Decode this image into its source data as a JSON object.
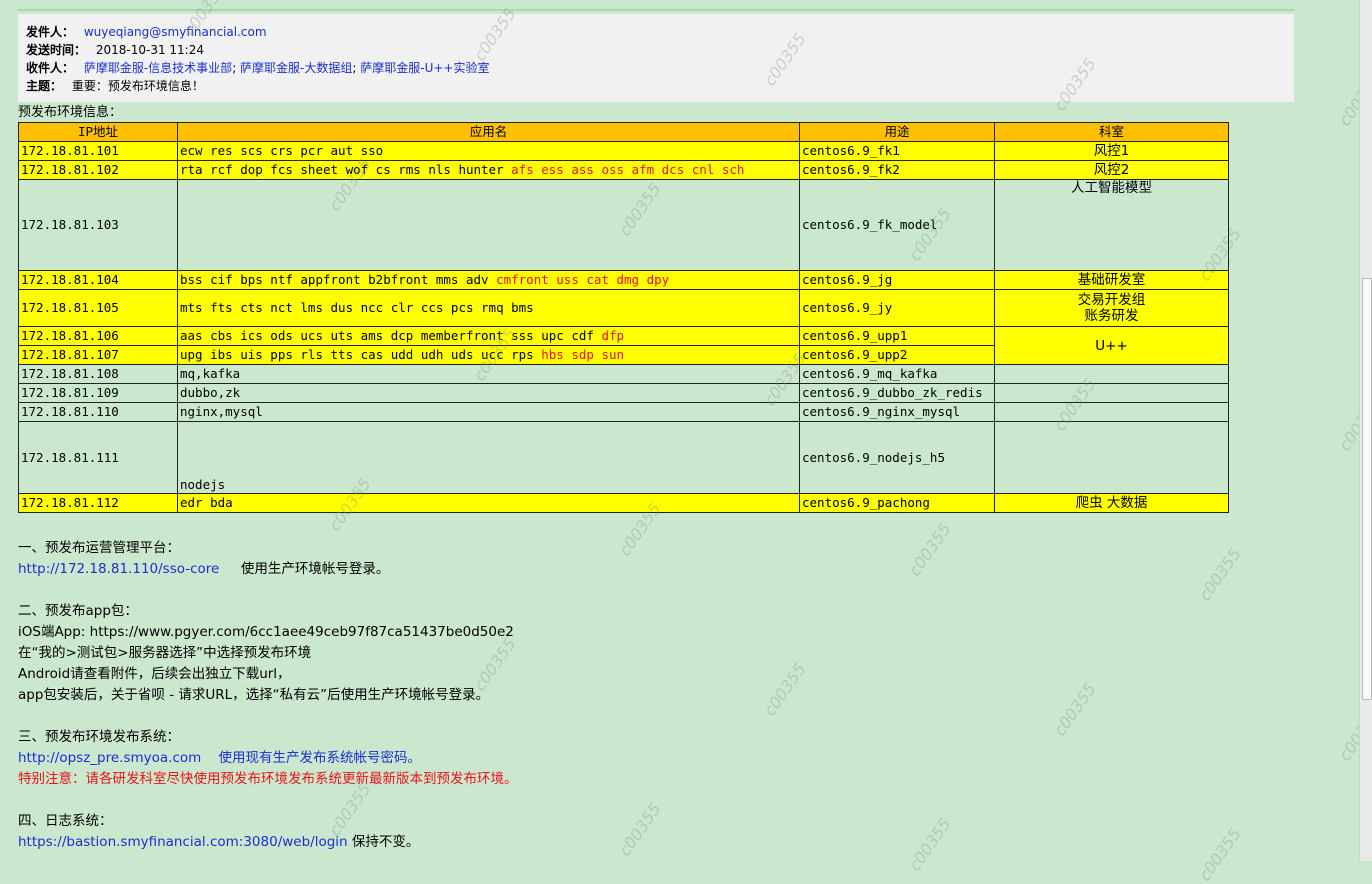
{
  "email": {
    "from_label": "发件人：",
    "from": "wuyeqiang@smyfinancial.com",
    "sent_label": "发送时间：",
    "sent": "2018-10-31 11:24",
    "to_label": "收件人：",
    "to": [
      "萨摩耶金服-信息技术事业部",
      "萨摩耶金服-大数据组",
      "萨摩耶金服-U++实验室"
    ],
    "subject_label": "主题：",
    "subject": "重要：预发布环境信息！"
  },
  "intro": "预发布环境信息：",
  "table": {
    "headers": [
      "IP地址",
      "应用名",
      "用途",
      "科室"
    ],
    "rows": [
      {
        "ip": "172.18.81.101",
        "apps": "ecw res scs crs pcr aut sso",
        "apps_red": "",
        "use": "centos6.9_fk1",
        "dept": "风控1"
      },
      {
        "ip": "172.18.81.102",
        "apps": "rta rcf dop fcs sheet wof cs rms nls hunter ",
        "apps_red": "afs ess ass oss afm dcs cnl sch",
        "use": "centos6.9_fk2",
        "dept": "风控2"
      },
      {
        "ip": "172.18.81.103",
        "apps": "",
        "apps_red": "",
        "use": "centos6.9_fk_model",
        "dept": "人工智能模型"
      },
      {
        "ip": "172.18.81.104",
        "apps": "bss cif bps ntf appfront b2bfront mms adv ",
        "apps_red": "cmfront uss cat dmg dpy",
        "use": "centos6.9_jg",
        "dept": "基础研发室"
      },
      {
        "ip": "172.18.81.105",
        "apps": "mts fts cts nct lms dus ncc clr ccs pcs rmq bms",
        "apps_red": "",
        "use": "centos6.9_jy",
        "dept": "交易开发组",
        "dept2": "账务研发"
      },
      {
        "ip": "172.18.81.106",
        "apps": "aas cbs ics ods ucs uts ams dcp memberfront sss upc cdf ",
        "apps_red": "dfp",
        "use": "centos6.9_upp1",
        "dept": "U++"
      },
      {
        "ip": "172.18.81.107",
        "apps": "upg ibs uis pps rls tts cas udd udh uds ucc rps ",
        "apps_red": "hbs sdp sun",
        "use": "centos6.9_upp2"
      },
      {
        "ip": "172.18.81.108",
        "apps": "mq,kafka",
        "apps_red": "",
        "use": "centos6.9_mq_kafka",
        "dept": ""
      },
      {
        "ip": "172.18.81.109",
        "apps": "dubbo,zk",
        "apps_red": "",
        "use": "centos6.9_dubbo_zk_redis",
        "dept": ""
      },
      {
        "ip": "172.18.81.110",
        "apps": "nginx,mysql",
        "apps_red": "",
        "use": "centos6.9_nginx_mysql",
        "dept": ""
      },
      {
        "ip": "172.18.81.111",
        "apps": "nodejs",
        "apps_red": "",
        "use": "centos6.9_nodejs_h5",
        "dept": ""
      },
      {
        "ip": "172.18.81.112",
        "apps": "edr bda",
        "apps_red": "",
        "use": "centos6.9_pachong",
        "dept": "爬虫 大数据"
      }
    ]
  },
  "sections": {
    "s1_title": "一、预发布运营管理平台：",
    "s1_link": "http://172.18.81.110/sso-core",
    "s1_note": "使用生产环境帐号登录。",
    "s2_title": "二、预发布app包：",
    "s2_line1": "iOS端App: https://www.pgyer.com/6cc1aee49ceb97f87ca51437be0d50e2",
    "s2_line2": "在“我的>测试包>服务器选择”中选择预发布环境",
    "s2_line3": "Android请查看附件，后续会出独立下载url，",
    "s2_line4": "app包安装后，关于省呗 - 请求URL，选择“私有云”后使用生产环境帐号登录。",
    "s3_title": "三、预发布环境发布系统：",
    "s3_link": "http://opsz_pre.smyoa.com",
    "s3_note": "使用现有生产发布系统帐号密码。",
    "s3_warn": "特别注意：请各研发科室尽快使用预发布环境发布系统更新最新版本到预发布环境。",
    "s4_title": "四、日志系统：",
    "s4_link": "https://bastion.smyfinancial.com:3080/web/login",
    "s4_note": "保持不变。"
  },
  "watermark": "c00355",
  "colors": {
    "background": "#cbe8cf",
    "header": "#ffc000",
    "highlight": "#ffff00",
    "link": "#1a2fd0",
    "warn": "#e8141a"
  }
}
